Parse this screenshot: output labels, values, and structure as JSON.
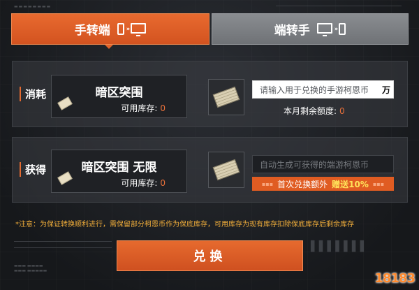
{
  "tabs": {
    "mobile_to_pc": "手转端",
    "pc_to_mobile": "端转手"
  },
  "consume": {
    "label": "消耗",
    "item_name": "暗区突围",
    "stock_label": "可用库存:",
    "stock_value": "0",
    "input_placeholder": "请输入用于兑换的手游柯恩币",
    "input_unit": "万",
    "quota_label": "本月剩余额度:",
    "quota_value": "0"
  },
  "gain": {
    "label": "获得",
    "item_name": "暗区突围 无限",
    "stock_label": "可用库存:",
    "stock_value": "0",
    "output_placeholder": "自动生成可获得的端游柯恩币",
    "bonus_text": "首次兑换额外",
    "bonus_highlight": "赠送10%"
  },
  "notice": "*注意：为保证转换顺利进行，需保留部分柯恩币作为保底库存，可用库存为现有库存扣除保底库存后剩余库存",
  "confirm_label": "兑换",
  "watermark": "18183"
}
